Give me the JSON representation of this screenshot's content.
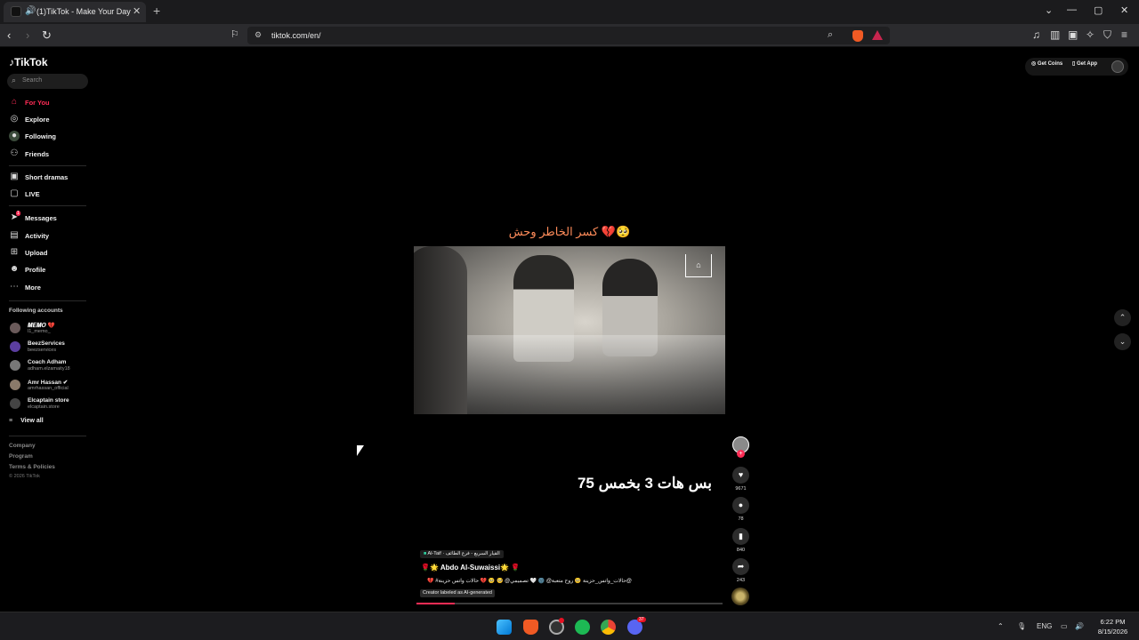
{
  "browser": {
    "tab_title": "(1)TikTok - Make Your Day",
    "url": "tiktok.com/en/",
    "new_tab": "+",
    "controls": {
      "minimize": "—",
      "maximize": "▢",
      "close": "✕",
      "tab_list": "⌄"
    },
    "brave_badge": "2"
  },
  "tiktok": {
    "logo": "TikTok",
    "search_placeholder": "Search",
    "nav": [
      {
        "label": "For You",
        "icon": "home-icon",
        "active": true
      },
      {
        "label": "Explore",
        "icon": "compass-icon"
      },
      {
        "label": "Following",
        "icon": "following-icon"
      },
      {
        "label": "Friends",
        "icon": "friends-icon"
      },
      {
        "label": "Short dramas",
        "icon": "drama-icon"
      },
      {
        "label": "LIVE",
        "icon": "live-icon"
      },
      {
        "label": "Messages",
        "icon": "messages-icon",
        "badge": "1"
      },
      {
        "label": "Activity",
        "icon": "activity-icon"
      },
      {
        "label": "Upload",
        "icon": "upload-icon"
      },
      {
        "label": "Profile",
        "icon": "profile-icon"
      },
      {
        "label": "More",
        "icon": "more-icon"
      }
    ],
    "following_title": "Following accounts",
    "accounts": [
      {
        "name": "𝑴𝑬𝑴𝑶 💔",
        "handle": "l1_memo_"
      },
      {
        "name": "BeezServices",
        "handle": "beezservices"
      },
      {
        "name": "Coach Adham",
        "handle": "adham.elzamaity18"
      },
      {
        "name": "Amr Hassan ✔",
        "handle": "amrhassan_official"
      },
      {
        "name": "Elcaptain store",
        "handle": "elcaptain.store"
      }
    ],
    "view_all": "View all",
    "footer": [
      "Company",
      "Program",
      "Terms & Policies"
    ],
    "copyright": "© 2026 TikTok",
    "get_coins": "Get Coins",
    "get_app": "Get App"
  },
  "video": {
    "caption_top": "كسر الخاطر وحش 💔🥺",
    "caption_bottom": "75 بس هات 3 بخمس",
    "location": "Al-Taif · القيار السريع - فرع الطائف",
    "author": "🌹🌟 Abdo Al-Suwaissi🌟 🌹",
    "description": "💔 #حالات_واتس_حزينة 🥺 روح متعبة@ 🌚 🤍 تصميمي@ 🥺 🥺 💔 حالات واتس حزينة@",
    "ai_label": "Creator labeled as AI-generated",
    "likes": "9671",
    "comments": "78",
    "saves": "840",
    "shares": "243",
    "progress_percent": 12.5
  },
  "taskbar": {
    "lang": "ENG",
    "time": "6:22 PM",
    "date": "8/15/2026",
    "notification_badge": "37"
  }
}
